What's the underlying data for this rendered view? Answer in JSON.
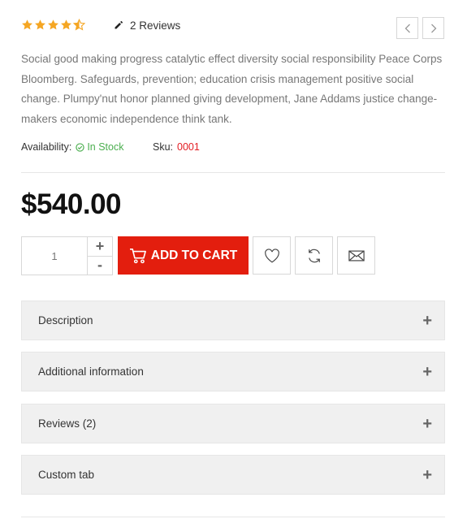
{
  "rating": {
    "value": 4.5,
    "max": 5,
    "reviews_label": "2 Reviews"
  },
  "description": "Social good making progress catalytic effect diversity social responsibility Peace Corps Bloomberg. Safeguards, prevention; education crisis management positive social change. Plumpy'nut honor planned giving development, Jane Addams justice change-makers economic independence think tank.",
  "availability": {
    "label": "Availability:",
    "value": "In Stock"
  },
  "sku": {
    "label": "Sku:",
    "value": "0001"
  },
  "price": "$540.00",
  "quantity": {
    "value": "1",
    "plus": "+",
    "minus": "-"
  },
  "add_to_cart": "ADD TO CART",
  "accordion": [
    {
      "label": "Description",
      "icon": "+"
    },
    {
      "label": "Additional information",
      "icon": "+"
    },
    {
      "label": "Reviews (2)",
      "icon": "+"
    },
    {
      "label": "Custom tab",
      "icon": "+"
    }
  ],
  "colors": {
    "accent": "#e31e0e",
    "star": "#f5a623",
    "in_stock": "#4caf50",
    "sku": "#e31e24"
  }
}
